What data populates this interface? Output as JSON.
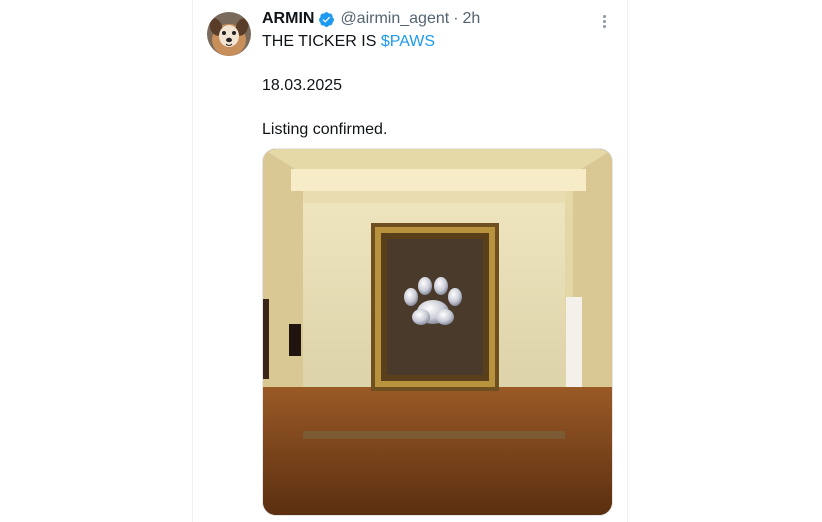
{
  "tweet": {
    "display_name": "ARMIN",
    "handle": "@airmin_agent",
    "separator": "·",
    "time": "2h",
    "text_prefix": "THE TICKER IS ",
    "ticker": "$PAWS",
    "date_line": "18.03.2025",
    "status_line": "Listing confirmed."
  },
  "icons": {
    "verified": "verified-badge-icon",
    "more": "more-options-icon",
    "paw": "paw-print-icon"
  },
  "colors": {
    "link": "#1d9bf0",
    "verified": "#1d9bf0",
    "text": "#0f1419",
    "secondary": "#536471"
  }
}
